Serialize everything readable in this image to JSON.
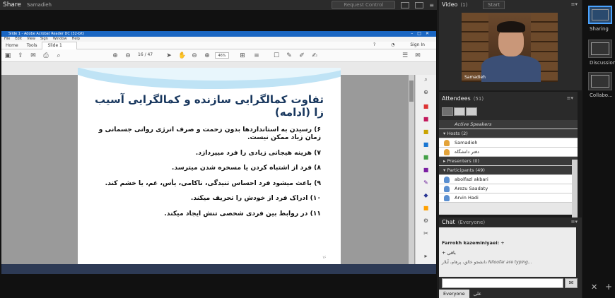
{
  "share": {
    "title": "Share",
    "presenter": "Samadieh",
    "request_control": "Request Control"
  },
  "acrobat": {
    "window_title": "Slide 1 - Adobe Acrobat Reader DC (32-bit)",
    "menu": [
      "File",
      "Edit",
      "View",
      "Sign",
      "Window",
      "Help"
    ],
    "tabs": [
      "Home",
      "Tools"
    ],
    "doc_tab": "Slide 1",
    "sign_in": "Sign In",
    "page_current": "16",
    "page_total": "/ 47",
    "zoom": "46%"
  },
  "slide": {
    "title": "تفاوت کمالگرایی سازنده و کمالگرایی آسیب زا (ادامه)",
    "lines": [
      "۶) رسیدن به استانداردها بدون زحمت و صرف انرژی روانی جسمانی و زمان زیاد ممکن نیست.",
      "۷) هزینه هیجانی زیادی را فرد میپردازد.",
      "۸) فرد از اشتباه کردن یا مسخره شدن میترسد.",
      "۹) باعث میشود فرد احساس تنیدگی، ناکامی، یأس، غم، یا خشم کند.",
      "۱۰) ادراک فرد از خودش را تحریف میکند.",
      "۱۱) در روابط بین فردی شخصی تنش ایجاد میکند."
    ],
    "page_number": "۱۶"
  },
  "video": {
    "title": "Video",
    "count": "(1)",
    "start": "Start",
    "name_label": "Samadieh"
  },
  "attendees": {
    "title": "Attendees",
    "count": "(51)",
    "active_speakers": "Active Speakers",
    "hosts_label": "Hosts (2)",
    "hosts": [
      "Samadieh",
      "دفتر دانشگاه"
    ],
    "presenters_label": "Presenters (0)",
    "participants_label": "Participants (49)",
    "participants": [
      "abolfazl akbari",
      "Arezu Saadaty",
      "Arvin Hadi"
    ]
  },
  "chat": {
    "title": "Chat",
    "scope": "(Everyone)",
    "messages": [
      {
        "author": "Farrokh kazeminiyaei:",
        "text": "+"
      },
      {
        "author": "",
        "text": "+ باقی"
      }
    ],
    "typing": "Niloofar are typing...",
    "typing_prefix": "دانشجو خالق، پرهام، آیلار",
    "tab_everyone": "Everyone",
    "tab_other": "علی"
  },
  "layouts": {
    "items": [
      "Sharing",
      "Discussion",
      "Collabo..."
    ]
  }
}
